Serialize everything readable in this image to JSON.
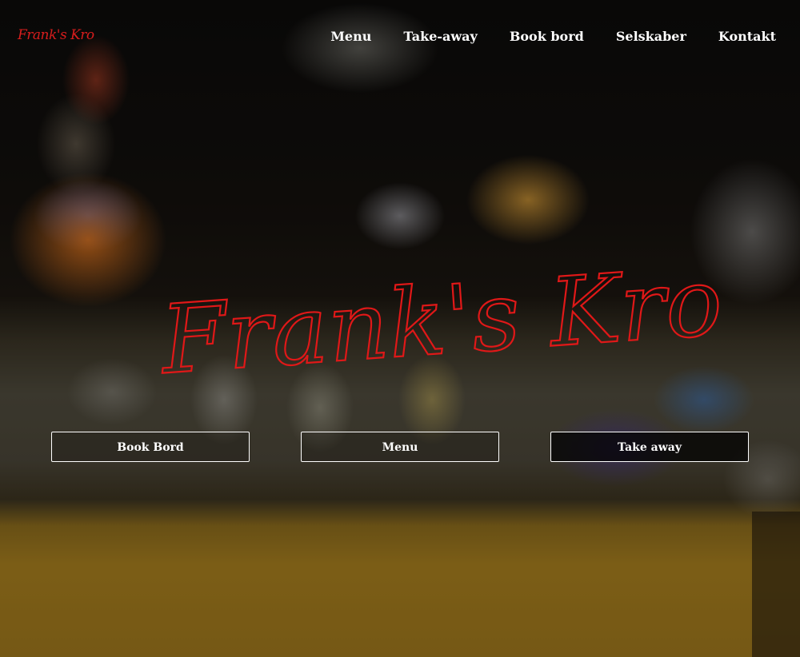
{
  "brand": {
    "logo_text": "Frank's Kro",
    "hero_title": "Frank's Kro",
    "accent_color": "#e01818"
  },
  "nav": {
    "items": [
      {
        "label": "Menu"
      },
      {
        "label": "Take-away"
      },
      {
        "label": "Book bord"
      },
      {
        "label": "Selskaber"
      },
      {
        "label": "Kontakt"
      }
    ]
  },
  "hero": {
    "buttons": [
      {
        "label": "Book Bord"
      },
      {
        "label": "Menu"
      },
      {
        "label": "Take away"
      }
    ]
  }
}
